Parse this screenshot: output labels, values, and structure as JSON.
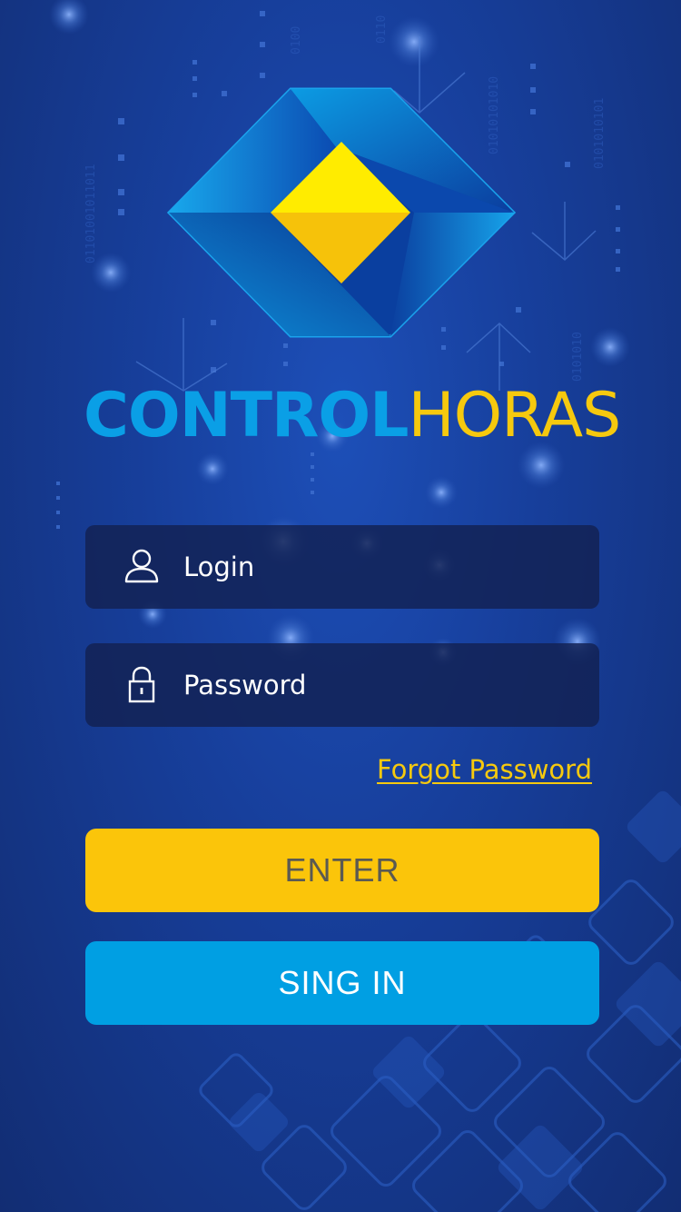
{
  "app": {
    "brand_part1": "CONTROL",
    "brand_part2": "HORAS"
  },
  "form": {
    "login_placeholder": "Login",
    "login_value": "",
    "password_placeholder": "Password",
    "password_value": "",
    "forgot_label": "Forgot Password"
  },
  "buttons": {
    "enter_label": "ENTER",
    "signin_label": "SING IN"
  },
  "icons": {
    "login": "user-icon",
    "password": "lock-icon"
  },
  "colors": {
    "background": "#173f9c",
    "brand_blue": "#0a9fe6",
    "brand_yellow": "#f6c90e",
    "field_bg": "#122152",
    "enter_button": "#fbc50a",
    "signin_button": "#009fe3"
  }
}
